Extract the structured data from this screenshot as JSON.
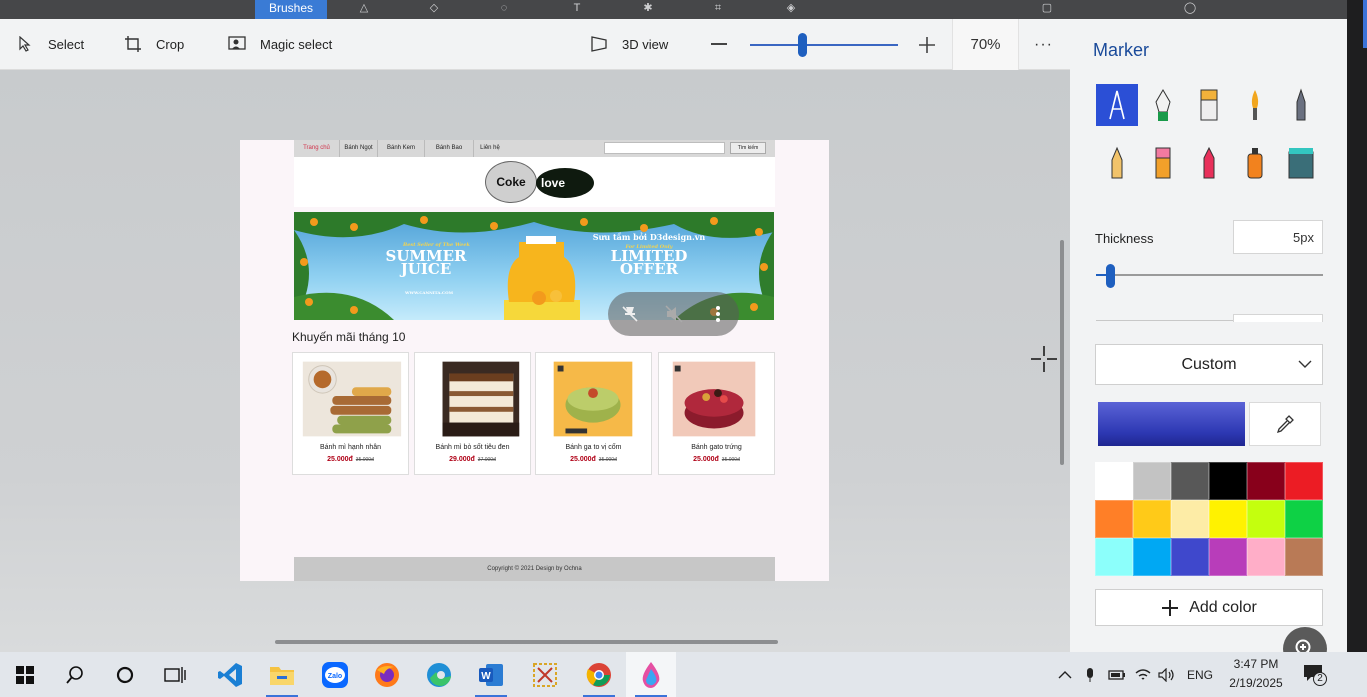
{
  "topbar": {
    "active_tab": "Brushes"
  },
  "toolbar": {
    "select_label": "Select",
    "crop_label": "Crop",
    "magic_select_label": "Magic select",
    "view3d_label": "3D view",
    "zoom_value": "70%",
    "zoom_level_fraction": 0.35
  },
  "webpage": {
    "nav": [
      "Trang chủ",
      "Bánh Ngọt",
      "Bánh Kem",
      "Bánh Bao",
      "Liên hệ"
    ],
    "search_button": "Tìm kiếm",
    "logo_left": "Coke",
    "logo_right": "love",
    "banner": {
      "left_small": "Best Seller of The Week",
      "left_big1": "SUMMER",
      "left_big2": "JUICE",
      "left_url": "WWW.CANNITA.COM",
      "right_top": "Sưu tầm bởi D3design.vn",
      "right_small": "For Limited Only",
      "right_big1": "LIMITED",
      "right_big2": "OFFER"
    },
    "promo_title": "Khuyến mãi tháng 10",
    "products": [
      {
        "name": "Bánh mì hạnh nhân",
        "price": "25.000đ",
        "old_price": "35.000đ"
      },
      {
        "name": "Bánh mì bò sốt tiêu đen",
        "price": "29.000đ",
        "old_price": "37.000đ"
      },
      {
        "name": "Bánh ga to vị cốm",
        "price": "25.000đ",
        "old_price": "35.000đ"
      },
      {
        "name": "Bánh gato trứng",
        "price": "25.000đ",
        "old_price": "35.000đ"
      }
    ],
    "footer": "Copyright © 2021 Design by Ochna"
  },
  "panel": {
    "title": "Marker",
    "thickness_label": "Thickness",
    "thickness_value": "5px",
    "thickness_fraction": 0.03,
    "color_mode": "Custom",
    "selected_color": "#3e46c7",
    "palette": [
      "#ffffff",
      "#c3c3c3",
      "#585858",
      "#000000",
      "#88001b",
      "#ec1c24",
      "#ff7f27",
      "#ffca18",
      "#fdeca6",
      "#fff200",
      "#c4ff0e",
      "#0ed145",
      "#8cfffb",
      "#00a8f3",
      "#3f48cc",
      "#b83dba",
      "#ffaec8",
      "#b97a56"
    ],
    "add_color_label": "Add color"
  },
  "taskbar": {
    "tray_language": "ENG",
    "time": "3:47 PM",
    "date": "2/19/2025",
    "notification_count": "2"
  }
}
